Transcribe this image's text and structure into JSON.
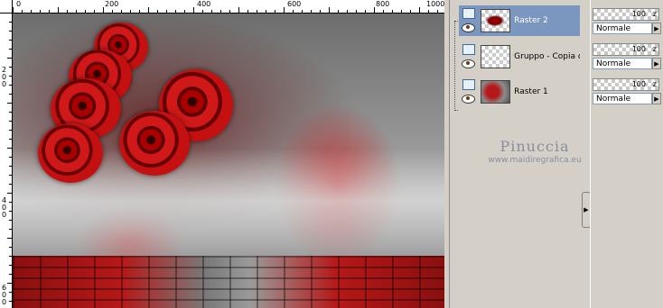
{
  "ruler": {
    "top_labels": [
      "0",
      "200",
      "400",
      "600",
      "800",
      "1000"
    ],
    "left_labels": [
      "200",
      "400",
      "600"
    ]
  },
  "layers": [
    {
      "name": "Raster 2",
      "selected": true,
      "opacity": "100",
      "blend": "Normale"
    },
    {
      "name": "Gruppo - Copia di",
      "selected": false,
      "opacity": "100",
      "blend": "Normale"
    },
    {
      "name": "Raster 1",
      "selected": false,
      "opacity": "100",
      "blend": "Normale"
    }
  ],
  "watermark": {
    "name": "Pinuccia",
    "url": "www.maidiregrafica.eu"
  },
  "icons": {
    "layer_type": "raster-layer-icon",
    "visibility": "eye-icon",
    "blend_dropdown": "triangle-right-icon",
    "splitter": "triangle-right-icon"
  },
  "colors": {
    "selected_row": "#7b97c0",
    "panel_bg": "#d4d0c8",
    "rose_red": "#c41010"
  }
}
